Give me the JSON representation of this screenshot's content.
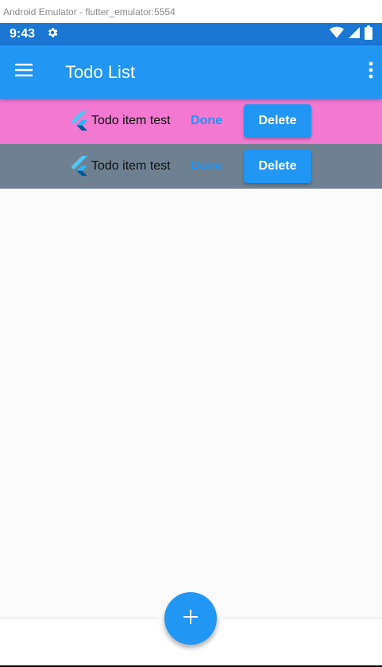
{
  "window": {
    "title": "Android Emulator - flutter_emulator:5554"
  },
  "status_bar": {
    "time": "9:43"
  },
  "app_bar": {
    "title": "Todo List"
  },
  "todos": [
    {
      "text": "Todo item test",
      "done_label": "Done",
      "delete_label": "Delete",
      "background": "#f278d2"
    },
    {
      "text": "Todo item test",
      "done_label": "Done",
      "delete_label": "Delete",
      "background": "#6f8090"
    }
  ],
  "colors": {
    "primary": "#2196f3",
    "status_bar": "#1976d2"
  },
  "icons": {
    "menu": "menu-icon",
    "more": "more-vert-icon",
    "add": "add-icon",
    "settings": "gear-icon",
    "wifi": "wifi-icon",
    "signal": "signal-icon",
    "battery": "battery-icon",
    "todo_logo": "flutter-logo-icon"
  }
}
